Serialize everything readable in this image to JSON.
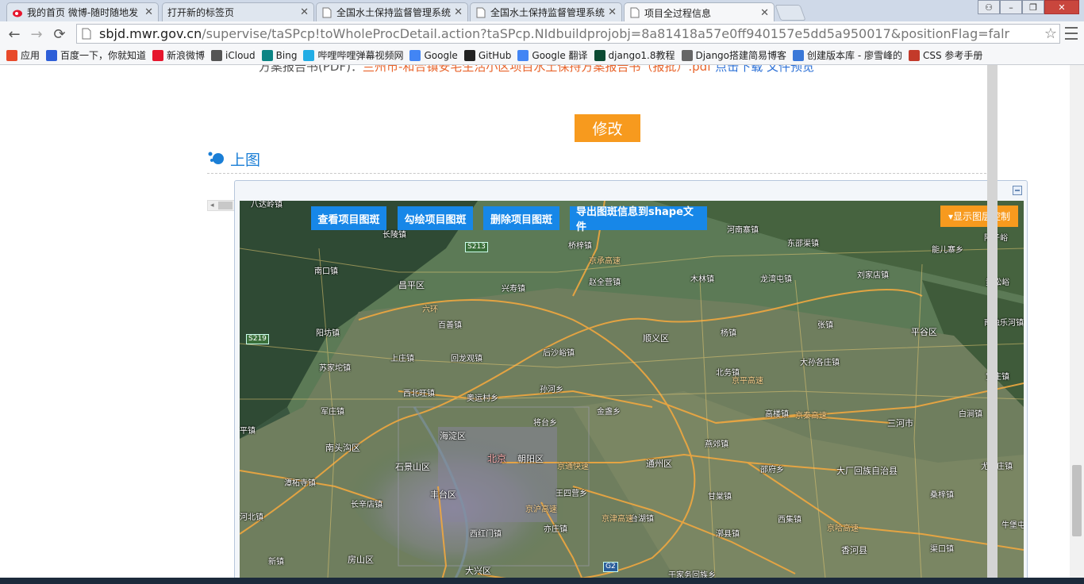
{
  "browser": {
    "tabs": [
      {
        "label": "我的首页 微博-随时随地发",
        "icon": "weibo-icon",
        "active": false
      },
      {
        "label": "打开新的标签页",
        "icon": "",
        "active": false
      },
      {
        "label": "全国水土保持监督管理系统",
        "icon": "page-icon",
        "active": false
      },
      {
        "label": "全国水土保持监督管理系统",
        "icon": "page-icon",
        "active": false
      },
      {
        "label": "项目全过程信息",
        "icon": "page-icon",
        "active": true
      }
    ],
    "url_host": "sbjd.mwr.gov.cn",
    "url_rest": "/supervise/taSPcp!toWholeProcDetail.action?taSPcp.NIdbuildprojobj=8a81418a57e0ff940157e5dd5a950017&positionFlag=falr",
    "bookmarks": [
      {
        "label": "应用",
        "icon": "apps-icon",
        "color": "#e84a2a"
      },
      {
        "label": "百度一下，你就知道",
        "icon": "baidu-icon",
        "color": "#2e5fd8"
      },
      {
        "label": "新浪微博",
        "icon": "weibo-icon",
        "color": "#e6162d"
      },
      {
        "label": "iCloud",
        "icon": "apple-icon",
        "color": "#555555"
      },
      {
        "label": "Bing",
        "icon": "bing-icon",
        "color": "#0c8484"
      },
      {
        "label": "哔哩哔哩弹幕视频网",
        "icon": "bilibili-icon",
        "color": "#23ade5"
      },
      {
        "label": "Google",
        "icon": "google-icon",
        "color": "#4285f4"
      },
      {
        "label": "GitHub",
        "icon": "github-icon",
        "color": "#222222"
      },
      {
        "label": "Google 翻译",
        "icon": "google-icon",
        "color": "#4285f4"
      },
      {
        "label": "django1.8教程",
        "icon": "django-icon",
        "color": "#0c4b33"
      },
      {
        "label": "Django搭建简易博客",
        "icon": "book-icon",
        "color": "#666666"
      },
      {
        "label": "创建版本库 - 廖雪峰的",
        "icon": "rocket-icon",
        "color": "#3a78d8"
      },
      {
        "label": "CSS 参考手册",
        "icon": "w3-icon",
        "color": "#c33a2a"
      }
    ]
  },
  "page": {
    "cut_text_prefix": "方案报告书(PDF)：",
    "cut_text_link": "兰州市-和合镇安宅生活小区项目水土保持方案报告书（报批）.pdf",
    "cut_text_suffix": "点击下载 文件预览",
    "modify_button": "修改",
    "section_title": "上图",
    "map_buttons": {
      "view": "查看项目图斑",
      "draw": "勾绘项目图斑",
      "delete": "删除项目图斑",
      "export": "导出图斑信息到shape文件"
    },
    "layer_control": "▾显示图层控制"
  },
  "map": {
    "places": [
      {
        "name": "八达岭镇",
        "type": "town"
      },
      {
        "name": "长陵镇",
        "type": "town"
      },
      {
        "name": "桥梓镇",
        "type": "town"
      },
      {
        "name": "河南寨镇",
        "type": "town"
      },
      {
        "name": "东邵渠镇",
        "type": "town"
      },
      {
        "name": "陆子峪",
        "type": "town"
      },
      {
        "name": "能儿寨乡",
        "type": "town"
      },
      {
        "name": "南口镇",
        "type": "town"
      },
      {
        "name": "昌平区",
        "type": "district"
      },
      {
        "name": "兴寿镇",
        "type": "town"
      },
      {
        "name": "赵全营镇",
        "type": "town"
      },
      {
        "name": "木林镇",
        "type": "town"
      },
      {
        "name": "龙湾屯镇",
        "type": "town"
      },
      {
        "name": "刘家店镇",
        "type": "town"
      },
      {
        "name": "黄松峪",
        "type": "town"
      },
      {
        "name": "阳坊镇",
        "type": "town"
      },
      {
        "name": "百善镇",
        "type": "town"
      },
      {
        "name": "顺义区",
        "type": "district"
      },
      {
        "name": "杨镇",
        "type": "town"
      },
      {
        "name": "张镇",
        "type": "town"
      },
      {
        "name": "平谷区",
        "type": "district"
      },
      {
        "name": "南独乐河镇",
        "type": "town"
      },
      {
        "name": "上庄镇",
        "type": "town"
      },
      {
        "name": "回龙观镇",
        "type": "town"
      },
      {
        "name": "后沙峪镇",
        "type": "town"
      },
      {
        "name": "苏家坨镇",
        "type": "town"
      },
      {
        "name": "北务镇",
        "type": "town"
      },
      {
        "name": "大孙各庄镇",
        "type": "town"
      },
      {
        "name": "西北旺镇",
        "type": "town"
      },
      {
        "name": "奥运村乡",
        "type": "town"
      },
      {
        "name": "孙河乡",
        "type": "town"
      },
      {
        "name": "宜庄镇",
        "type": "town"
      },
      {
        "name": "军庄镇",
        "type": "town"
      },
      {
        "name": "金盏乡",
        "type": "town"
      },
      {
        "name": "高楼镇",
        "type": "town"
      },
      {
        "name": "将台乡",
        "type": "town"
      },
      {
        "name": "三河市",
        "type": "district"
      },
      {
        "name": "白涧镇",
        "type": "town"
      },
      {
        "name": "平镇",
        "type": "town"
      },
      {
        "name": "海淀区",
        "type": "district"
      },
      {
        "name": "燕郊镇",
        "type": "town"
      },
      {
        "name": "北京",
        "type": "capital"
      },
      {
        "name": "朝阳区",
        "type": "district"
      },
      {
        "name": "南头沟区",
        "type": "district"
      },
      {
        "name": "石景山区",
        "type": "district"
      },
      {
        "name": "通州区",
        "type": "district"
      },
      {
        "name": "邵府乡",
        "type": "town"
      },
      {
        "name": "大厂回族自治县",
        "type": "district"
      },
      {
        "name": "尤古庄镇",
        "type": "town"
      },
      {
        "name": "潭柘寺镇",
        "type": "town"
      },
      {
        "name": "桑梓镇",
        "type": "town"
      },
      {
        "name": "丰台区",
        "type": "district"
      },
      {
        "name": "王四营乡",
        "type": "town"
      },
      {
        "name": "甘棠镇",
        "type": "town"
      },
      {
        "name": "长辛店镇",
        "type": "town"
      },
      {
        "name": "台湖镇",
        "type": "town"
      },
      {
        "name": "西集镇",
        "type": "town"
      },
      {
        "name": "河北镇",
        "type": "town"
      },
      {
        "name": "亦庄镇",
        "type": "town"
      },
      {
        "name": "西红门镇",
        "type": "town"
      },
      {
        "name": "漷县镇",
        "type": "town"
      },
      {
        "name": "牛堡屯",
        "type": "town"
      },
      {
        "name": "房山区",
        "type": "district"
      },
      {
        "name": "香河县",
        "type": "district"
      },
      {
        "name": "渠口镇",
        "type": "town"
      },
      {
        "name": "新镇",
        "type": "town"
      },
      {
        "name": "大兴区",
        "type": "district"
      },
      {
        "name": "于家务回族乡",
        "type": "town"
      }
    ],
    "roads": [
      {
        "name": "京承高速"
      },
      {
        "name": "六环"
      },
      {
        "name": "京平高速"
      },
      {
        "name": "京秦高速"
      },
      {
        "name": "京通快速"
      },
      {
        "name": "京哈高速"
      },
      {
        "name": "京津高速"
      },
      {
        "name": "京沪高速"
      }
    ],
    "badges": [
      "S213",
      "S219",
      "G2"
    ]
  }
}
